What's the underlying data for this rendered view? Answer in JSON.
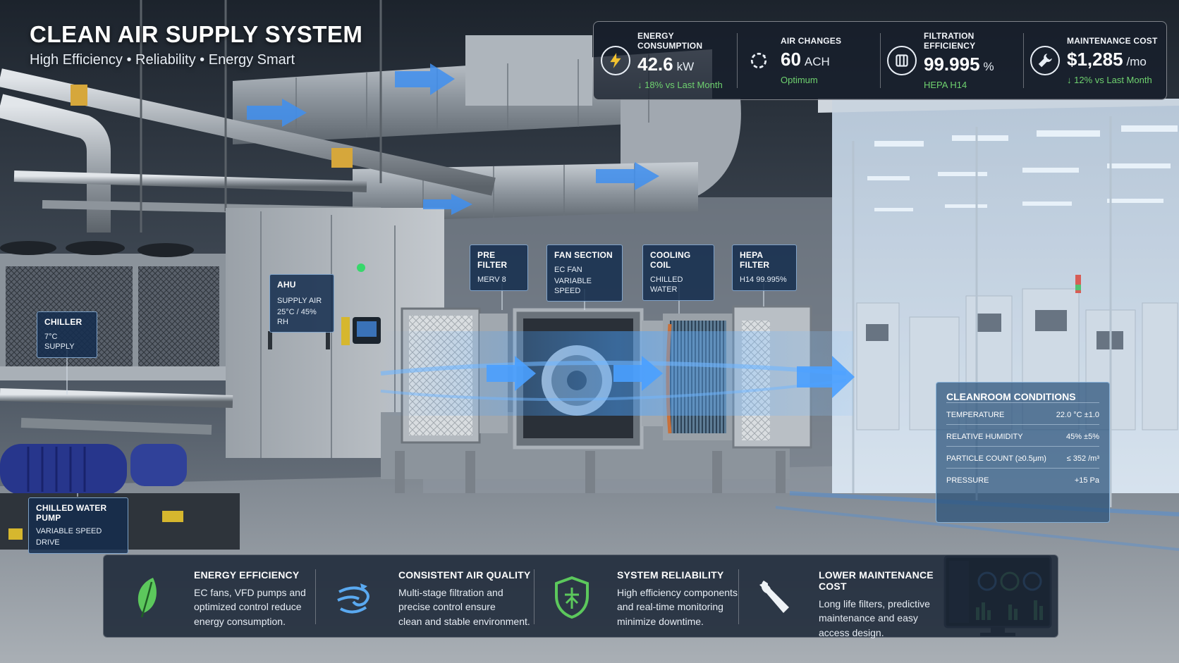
{
  "header": {
    "title": "CLEAN AIR SUPPLY SYSTEM",
    "subtitle": "High Efficiency • Reliability • Energy Smart"
  },
  "kpis": [
    {
      "icon": "lightning-icon",
      "label": "ENERGY CONSUMPTION",
      "value": "42.6",
      "unit": "kW",
      "note": "↓ 18% vs Last Month"
    },
    {
      "icon": "air-changes-icon",
      "label": "AIR CHANGES",
      "value": "60",
      "unit": "ACH",
      "note": "Optimum"
    },
    {
      "icon": "filter-icon",
      "label": "FILTRATION EFFICIENCY",
      "value": "99.995",
      "unit": "%",
      "note": "HEPA H14"
    },
    {
      "icon": "wrench-icon",
      "label": "MAINTENANCE COST",
      "value": "$1,285",
      "unit": "/mo",
      "note": "↓ 12% vs Last Month"
    }
  ],
  "callouts": {
    "chiller": {
      "title": "CHILLER",
      "sub": "7°C SUPPLY"
    },
    "ahu": {
      "title": "AHU",
      "sub1": "SUPPLY AIR",
      "sub2": "25°C / 45% RH"
    },
    "pre_filter": {
      "title": "PRE FILTER",
      "sub": "MERV 8"
    },
    "fan_section": {
      "title": "FAN SECTION",
      "sub1": "EC FAN",
      "sub2": "VARIABLE SPEED"
    },
    "cooling_coil": {
      "title": "COOLING COIL",
      "sub": "CHILLED WATER"
    },
    "hepa_filter": {
      "title": "HEPA FILTER",
      "sub": "H14 99.995%"
    },
    "pump": {
      "title": "CHILLED WATER PUMP",
      "sub1": "VARIABLE SPEED",
      "sub2": "DRIVE"
    }
  },
  "cleanroom": {
    "title": "CLEANROOM CONDITIONS",
    "rows": [
      {
        "label": "TEMPERATURE",
        "value": "22.0 °C ±1.0"
      },
      {
        "label": "RELATIVE HUMIDITY",
        "value": "45% ±5%"
      },
      {
        "label": "PARTICLE COUNT (≥0.5μm)",
        "value": "≤ 352 /m³"
      },
      {
        "label": "PRESSURE",
        "value": "+15 Pa"
      }
    ]
  },
  "benefits": [
    {
      "icon": "leaf-icon",
      "title": "ENERGY EFFICIENCY",
      "lines": [
        "EC fans, VFD pumps and",
        "optimized control reduce",
        "energy consumption."
      ]
    },
    {
      "icon": "air-swirl-icon",
      "title": "CONSISTENT AIR QUALITY",
      "lines": [
        "Multi-stage filtration and",
        "precise control ensure",
        "clean and stable environment."
      ]
    },
    {
      "icon": "shield-icon",
      "title": "SYSTEM RELIABILITY",
      "lines": [
        "High efficiency components",
        "and real-time monitoring",
        "minimize downtime."
      ]
    },
    {
      "icon": "wrench-icon",
      "title": "LOWER MAINTENANCE COST",
      "lines": [
        "Long life filters, predictive",
        "maintenance and easy",
        "access design."
      ]
    }
  ],
  "colors": {
    "accent_blue": "#3d8fe6",
    "good_green": "#6fd26f",
    "panel_dark": "#1c2838"
  }
}
